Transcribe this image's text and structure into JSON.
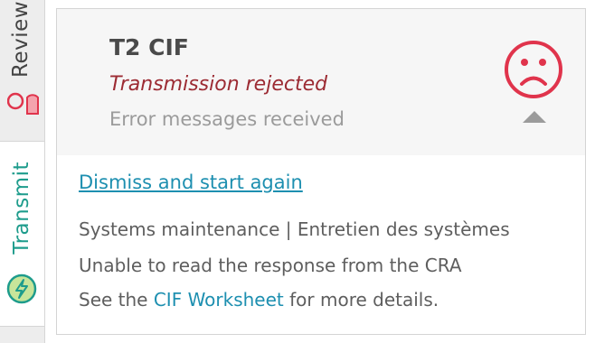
{
  "tabs": {
    "review": {
      "label": "Review",
      "icon": "person-icon"
    },
    "transmit": {
      "label": "Transmit",
      "icon": "bolt-circle-icon"
    }
  },
  "card": {
    "title": "T2 CIF",
    "status": "Transmission rejected",
    "subtext": "Error messages received",
    "status_icon": "sad-face-icon",
    "collapse_icon": "chevron-up-icon",
    "dismiss_link": "Dismiss and start again",
    "messages": {
      "line1": "Systems maintenance | Entretien des systèmes",
      "line2": "Unable to read the response from the CRA",
      "line3_prefix": "See the ",
      "line3_link": "CIF Worksheet",
      "line3_suffix": " for more details."
    }
  },
  "colors": {
    "error": "#9c2b33",
    "sad_face": "#e0344c",
    "link": "#1d8fb0",
    "transmit_accent": "#1e9c8c"
  }
}
